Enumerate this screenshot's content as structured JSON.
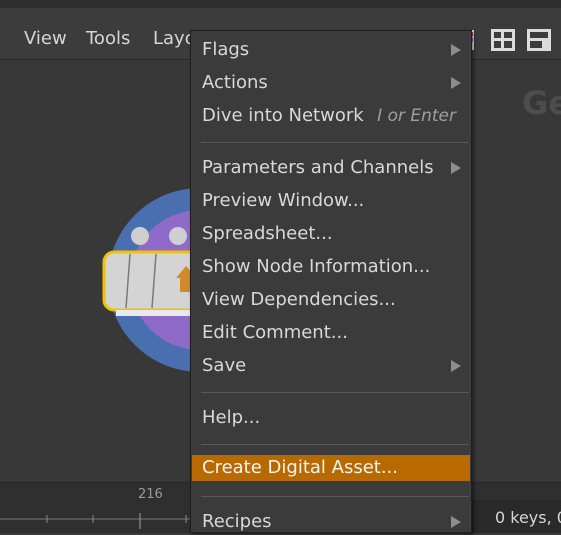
{
  "menubar": {
    "items": [
      {
        "label": "View"
      },
      {
        "label": "Tools"
      },
      {
        "label": "Layo"
      }
    ]
  },
  "network": {
    "title_partial": "Ge",
    "frame_label": "216",
    "keys_status": "0 keys, 0/"
  },
  "context_menu": {
    "items": [
      {
        "label": "Flags",
        "submenu": true
      },
      {
        "label": "Actions",
        "submenu": true
      },
      {
        "label": "Dive into Network",
        "shortcut": "I or Enter"
      },
      {
        "label": "Parameters and Channels",
        "submenu": true
      },
      {
        "label": "Preview Window..."
      },
      {
        "label": "Spreadsheet..."
      },
      {
        "label": "Show Node Information..."
      },
      {
        "label": "View Dependencies..."
      },
      {
        "label": "Edit Comment..."
      },
      {
        "label": "Save",
        "submenu": true
      },
      {
        "label": "Help..."
      },
      {
        "label": "Create Digital Asset...",
        "highlighted": true
      },
      {
        "label": "Recipes",
        "submenu": true
      }
    ]
  },
  "colors": {
    "highlight": "#b86a00",
    "node_outer": "#4a6fb0",
    "node_inner": "#8f6ac8",
    "node_selected_outline": "#f2c200"
  },
  "icons": [
    "scissors-icon",
    "pin-icon",
    "color-palette-icon",
    "grid-layout-icon",
    "pane-layout-icon",
    "node-icon",
    "submenu-arrow-icon"
  ]
}
